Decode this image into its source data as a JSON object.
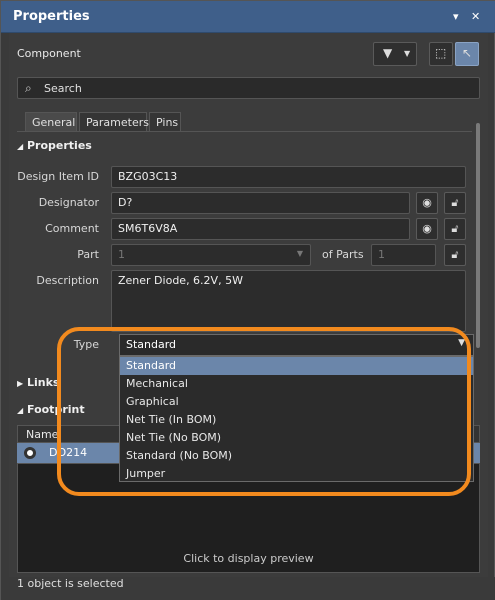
{
  "window": {
    "title": "Properties"
  },
  "header": {
    "component_label": "Component"
  },
  "search": {
    "placeholder": "Search"
  },
  "tabs": [
    {
      "label": "General"
    },
    {
      "label": "Parameters"
    },
    {
      "label": "Pins"
    }
  ],
  "sections": {
    "properties": "Properties",
    "links": "Links",
    "footprint": "Footprint"
  },
  "properties": {
    "design_item_id": {
      "label": "Design Item ID",
      "value": "BZG03C13"
    },
    "designator": {
      "label": "Designator",
      "value": "D?"
    },
    "comment": {
      "label": "Comment",
      "value": "SM6T6V8A"
    },
    "part": {
      "label": "Part",
      "value": "1",
      "of_parts_label": "of Parts",
      "of_parts_value": "1"
    },
    "description": {
      "label": "Description",
      "value": "Zener Diode, 6.2V, 5W"
    },
    "type": {
      "label": "Type",
      "value": "Standard"
    }
  },
  "type_dropdown": {
    "options": [
      "Standard",
      "Mechanical",
      "Graphical",
      "Net Tie (In BOM)",
      "Net Tie (No BOM)",
      "Standard (No BOM)",
      "Jumper"
    ],
    "selected": "Standard"
  },
  "footprint": {
    "column_name": "Name",
    "row_value": "DO214",
    "preview_text": "Click to display preview"
  },
  "status": {
    "text": "1 object is selected"
  },
  "colors": {
    "titlebar": "#3f5f8a",
    "selection": "#6b86aa",
    "highlight": "#f28a1e"
  },
  "icons": [
    "filter-icon",
    "select-icon",
    "pointer-icon",
    "search-icon",
    "eye-icon",
    "lock-icon",
    "chevron-down-icon",
    "close-icon",
    "pin-icon"
  ]
}
